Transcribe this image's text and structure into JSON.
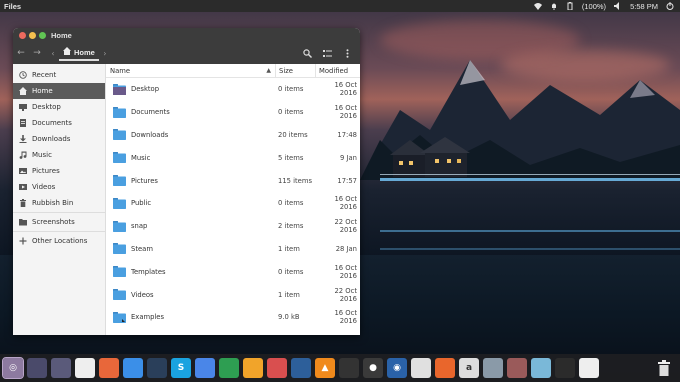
{
  "top_panel": {
    "app_name": "Files",
    "battery": "(100%)",
    "time": "5:58 PM",
    "icons": [
      "wifi-icon",
      "bell-icon",
      "battery-icon",
      "volume-icon",
      "power-icon"
    ]
  },
  "window": {
    "title": "Home",
    "path_current": "Home"
  },
  "sidebar": {
    "items": [
      {
        "label": "Recent",
        "icon": "clock-icon"
      },
      {
        "label": "Home",
        "icon": "home-icon"
      },
      {
        "label": "Desktop",
        "icon": "desktop-icon"
      },
      {
        "label": "Documents",
        "icon": "document-icon"
      },
      {
        "label": "Downloads",
        "icon": "download-icon"
      },
      {
        "label": "Music",
        "icon": "music-icon"
      },
      {
        "label": "Pictures",
        "icon": "picture-icon"
      },
      {
        "label": "Videos",
        "icon": "video-icon"
      },
      {
        "label": "Rubbish Bin",
        "icon": "trash-icon"
      },
      {
        "label": "Screenshots",
        "icon": "folder-icon"
      },
      {
        "label": "Other Locations",
        "icon": "plus-icon"
      }
    ]
  },
  "columns": {
    "name": "Name",
    "size": "Size",
    "modified": "Modified"
  },
  "files": [
    {
      "name": "Desktop",
      "size": "0 items",
      "modified": "16 Oct 2016",
      "icon": "desktop-folder-icon"
    },
    {
      "name": "Documents",
      "size": "0 items",
      "modified": "16 Oct 2016",
      "icon": "documents-folder-icon"
    },
    {
      "name": "Downloads",
      "size": "20 items",
      "modified": "17:48",
      "icon": "downloads-folder-icon"
    },
    {
      "name": "Music",
      "size": "5 items",
      "modified": "9 Jan",
      "icon": "music-folder-icon"
    },
    {
      "name": "Pictures",
      "size": "115 items",
      "modified": "17:57",
      "icon": "pictures-folder-icon"
    },
    {
      "name": "Public",
      "size": "0 items",
      "modified": "16 Oct 2016",
      "icon": "public-folder-icon"
    },
    {
      "name": "snap",
      "size": "2 items",
      "modified": "22 Oct 2016",
      "icon": "folder-icon"
    },
    {
      "name": "Steam",
      "size": "1 item",
      "modified": "28 Jan",
      "icon": "folder-icon"
    },
    {
      "name": "Templates",
      "size": "0 items",
      "modified": "16 Oct 2016",
      "icon": "templates-folder-icon"
    },
    {
      "name": "Videos",
      "size": "1 item",
      "modified": "22 Oct 2016",
      "icon": "videos-folder-icon"
    },
    {
      "name": "Examples",
      "size": "9.0 kB",
      "modified": "16 Oct 2016",
      "icon": "link-folder-icon"
    }
  ],
  "dock": {
    "apps": [
      {
        "name": "ubuntu-launcher-icon",
        "color": "#8d7aa0",
        "glyph": "◎"
      },
      {
        "name": "workspace-1-icon",
        "color": "#4a4a6a",
        "glyph": ""
      },
      {
        "name": "workspace-2-icon",
        "color": "#5a5a7a",
        "glyph": ""
      },
      {
        "name": "files-icon",
        "color": "#eeeeee",
        "glyph": ""
      },
      {
        "name": "firefox-icon",
        "color": "#e8673a",
        "glyph": ""
      },
      {
        "name": "chrome-icon",
        "color": "#3b8fe8",
        "glyph": ""
      },
      {
        "name": "steam-icon",
        "color": "#2a3f5a",
        "glyph": ""
      },
      {
        "name": "skype-icon",
        "color": "#1aa3e0",
        "glyph": "S"
      },
      {
        "name": "docs-icon",
        "color": "#4a86e8",
        "glyph": ""
      },
      {
        "name": "sheets-icon",
        "color": "#2e9e52",
        "glyph": ""
      },
      {
        "name": "slides-icon",
        "color": "#f1a42a",
        "glyph": ""
      },
      {
        "name": "writer-icon",
        "color": "#d94f4f",
        "glyph": ""
      },
      {
        "name": "inkscape-icon",
        "color": "#2d5f9a",
        "glyph": ""
      },
      {
        "name": "vlc-icon",
        "color": "#f08a1c",
        "glyph": "▲"
      },
      {
        "name": "terminal-alt-icon",
        "color": "#333333",
        "glyph": ""
      },
      {
        "name": "obs-icon",
        "color": "#3a3a3a",
        "glyph": "●"
      },
      {
        "name": "camera-icon",
        "color": "#2a62a8",
        "glyph": "◉"
      },
      {
        "name": "software-center-icon",
        "color": "#e0e0e0",
        "glyph": ""
      },
      {
        "name": "shopping-icon",
        "color": "#e9662c",
        "glyph": ""
      },
      {
        "name": "amazon-icon",
        "color": "#dddddd",
        "glyph": "a"
      },
      {
        "name": "equalizer-icon",
        "color": "#8a9aa8",
        "glyph": ""
      },
      {
        "name": "mixer-icon",
        "color": "#9a5a5a",
        "glyph": ""
      },
      {
        "name": "folder-app-icon",
        "color": "#7ab8d8",
        "glyph": ""
      },
      {
        "name": "terminal-icon",
        "color": "#2b2b2b",
        "glyph": ""
      },
      {
        "name": "screenshot-icon",
        "color": "#eeeeee",
        "glyph": ""
      }
    ],
    "trash": "trash-dock-icon"
  }
}
